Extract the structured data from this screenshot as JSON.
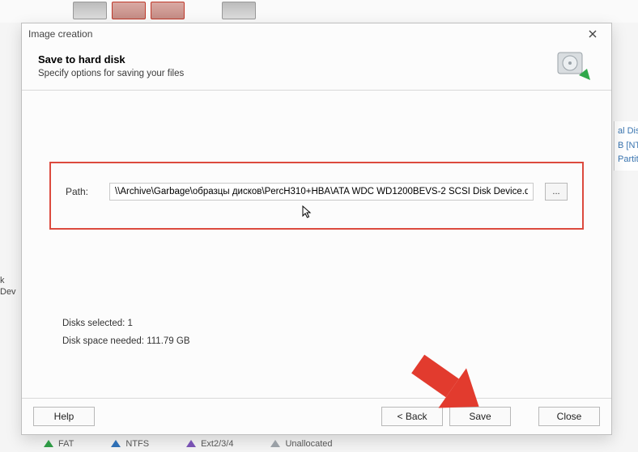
{
  "dialog": {
    "title": "Image creation",
    "header_title": "Save to hard disk",
    "header_subtitle": "Specify options for saving your files"
  },
  "path": {
    "label": "Path:",
    "value": "\\\\Archive\\Garbage\\образцы дисков\\PercH310+HBA\\ATA WDC WD1200BEVS-2 SCSI Disk Device.dsk",
    "browse_label": "..."
  },
  "summary": {
    "disks_selected_label": "Disks selected:",
    "disks_selected_value": "1",
    "space_needed_label": "Disk space needed:",
    "space_needed_value": "111.79 GB"
  },
  "buttons": {
    "help": "Help",
    "back": "< Back",
    "save": "Save",
    "close": "Close"
  },
  "background": {
    "side_left": "k Dev",
    "side_right_line1": "al Disk",
    "side_right_line2": "B [NTFS",
    "side_right_line3": "Partiti"
  },
  "legend": {
    "fat": "FAT",
    "ntfs": "NTFS",
    "ext": "Ext2/3/4",
    "unalloc": "Unallocated"
  }
}
